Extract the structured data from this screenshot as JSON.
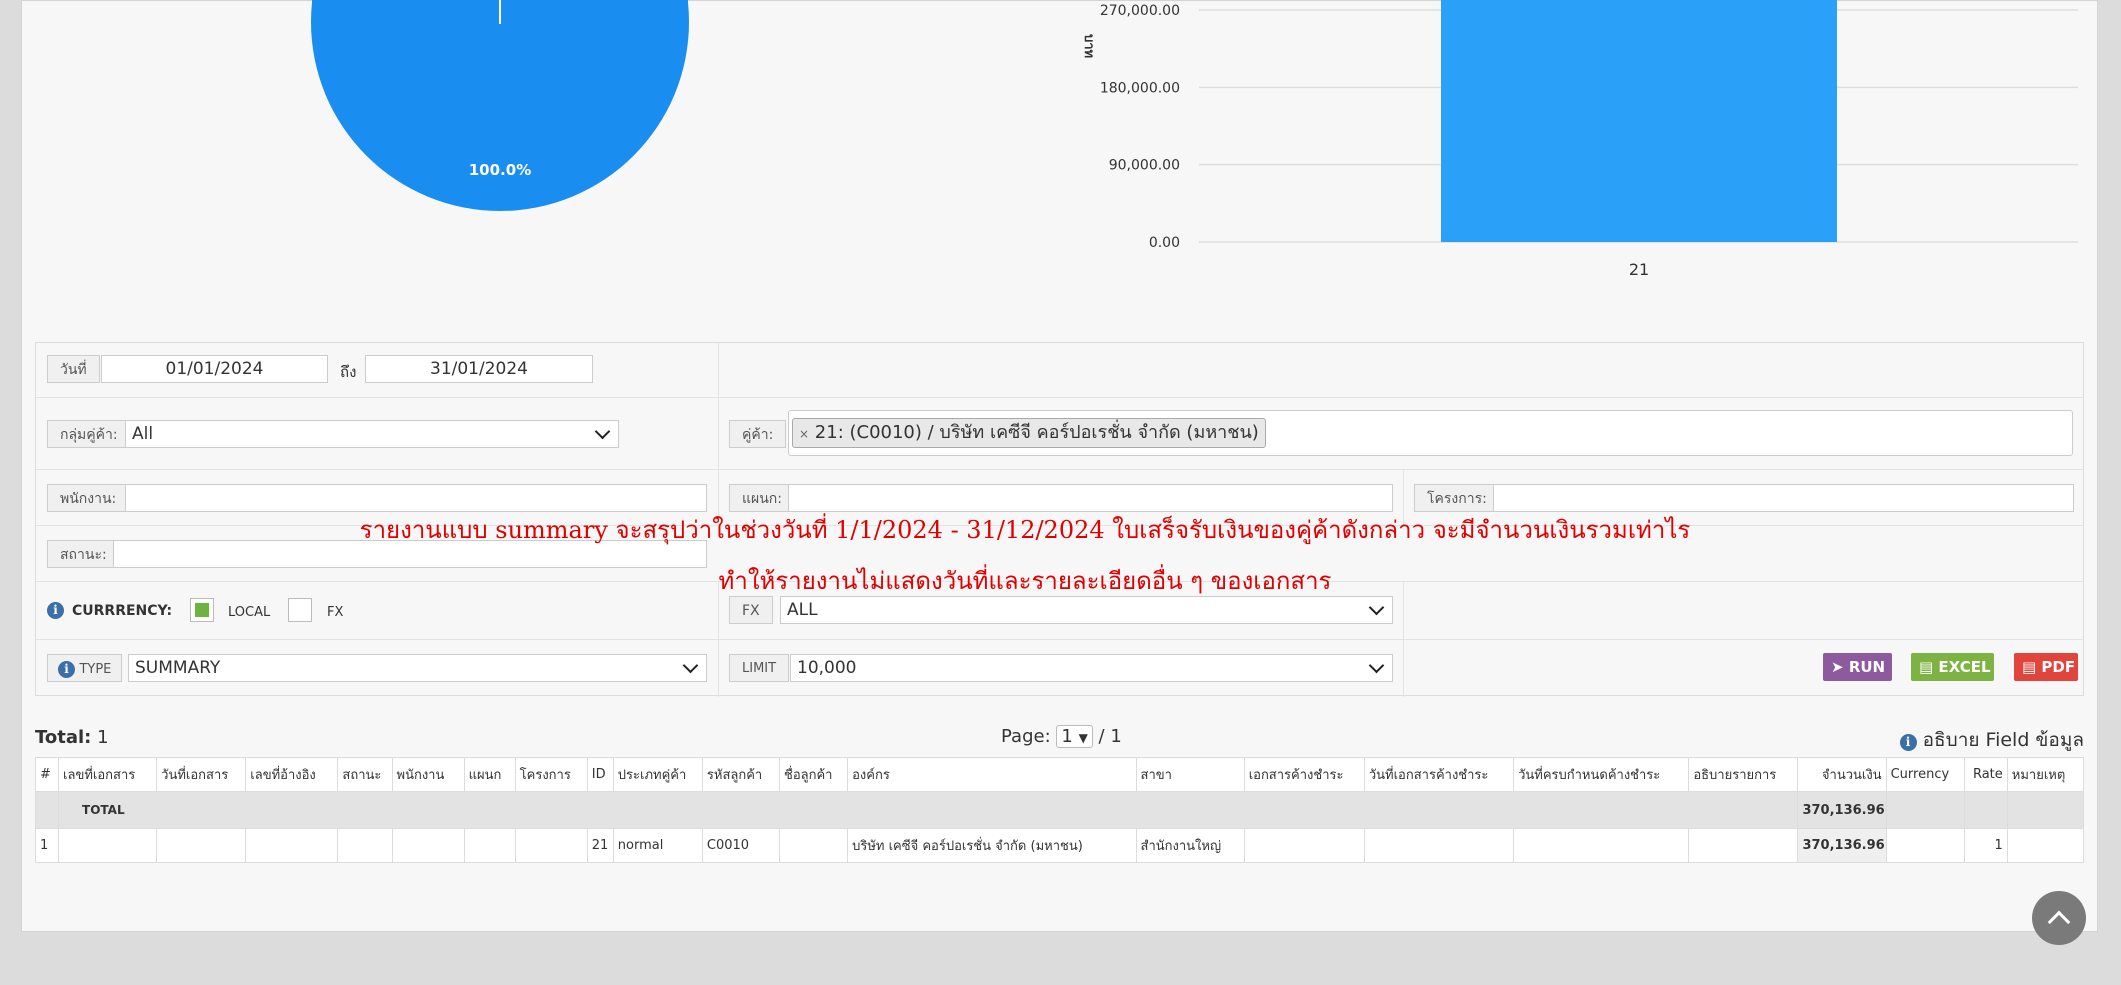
{
  "pie": {
    "label": "100.0%",
    "color": "#1a8ef0"
  },
  "chart_data": {
    "type": "bar",
    "categories": [
      "21"
    ],
    "values": [
      370136.96
    ],
    "ylabel": "บาท",
    "yticks": [
      "270,000.00",
      "180,000.00",
      "90,000.00",
      "0.00"
    ],
    "ytick_values": [
      270000,
      180000,
      90000,
      0
    ],
    "color": "#2aa0f8",
    "grid": true
  },
  "form": {
    "date_label": "วันที่",
    "date_from": "01/01/2024",
    "to_label": "ถึง",
    "date_to": "31/01/2024",
    "customer_group_label": "กลุ่มคู่ค้า:",
    "customer_group_value": "All",
    "customer_label": "คู่ค้า:",
    "customer_chip_x": "×",
    "customer_chip": "21: (C0010) / บริษัท เคซีจี คอร์ปอเรชั่น จำกัด (มหาชน)",
    "employee_label": "พนักงาน:",
    "department_label": "แผนก:",
    "project_label": "โครงการ:",
    "status_label": "สถานะ:",
    "currency_label": "CURRRENCY:",
    "local_label": "LOCAL",
    "fx_check_label": "FX",
    "fx_label": "FX",
    "fx_value": "ALL",
    "type_label": "TYPE",
    "type_value": "SUMMARY",
    "limit_label": "LIMIT",
    "limit_value": "10,000",
    "run_label": "RUN",
    "excel_label": "EXCEL",
    "pdf_label": "PDF",
    "run_color": "#8e5a9e",
    "excel_color": "#7cb342",
    "pdf_color": "#e0443a"
  },
  "overlay": {
    "line1": "รายงานแบบ summary จะสรุปว่าในช่วงวันที่ 1/1/2024 - 31/12/2024 ใบเสร็จรับเงินของคู่ค้าดังกล่าว จะมีจำนวนเงินรวมเท่าไร",
    "line2": "ทำให้รายงานไม่แสดงวันที่และรายละเอียดอื่น ๆ ของเอกสาร"
  },
  "summary": {
    "total_label": "Total:",
    "total_count": "1",
    "page_label": "Page:",
    "page_value": "1",
    "page_of": "/ 1",
    "field_help": "อธิบาย Field ข้อมูล"
  },
  "table": {
    "headers": [
      "#",
      "เลขที่เอกสาร",
      "วันที่เอกสาร",
      "เลขที่อ้างอิง",
      "สถานะ",
      "พนักงาน",
      "แผนก",
      "โครงการ",
      "ID",
      "ประเภทคู่ค้า",
      "รหัสลูกค้า",
      "ชื่อลูกค้า",
      "องค์กร",
      "สาขา",
      "เอกสารค้างชำระ",
      "วันที่เอกสารค้างชำระ",
      "วันที่ครบกำหนดค้างชำระ",
      "อธิบายรายการ",
      "จำนวนเงิน",
      "Currency",
      "Rate",
      "หมายเหตุ"
    ],
    "total_row": {
      "label": "TOTAL",
      "amount": "370,136.96"
    },
    "rows": [
      [
        "1",
        "",
        "",
        "",
        "",
        "",
        "",
        "",
        "21",
        "normal",
        "C0010",
        "",
        "บริษัท เคซีจี คอร์ปอเรชั่น จำกัด (มหาชน)",
        "สำนักงานใหญ่",
        "",
        "",
        "",
        "",
        "370,136.96",
        "",
        "1",
        ""
      ]
    ]
  }
}
